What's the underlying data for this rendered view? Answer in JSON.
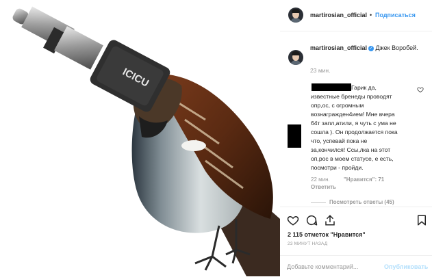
{
  "header": {
    "username": "martirosian_official",
    "separator": "•",
    "follow_label": "Подписаться"
  },
  "caption": {
    "username": "martirosian_official",
    "text": "Джек Воробей.",
    "time": "23 мин."
  },
  "comment": {
    "text_lines": [
      "Гарик да,",
      "известные бренеды проводят",
      "опр,ос, с огромным",
      "вознагражден4ием! Мне вчера",
      "64т запл,атили, я чуть с ума не",
      "сошла ). Он продолжается пока",
      "что, успевай пока не",
      "за,кончился! Ссы,лка на этот",
      "оп,рос в моем статусе, е есть,",
      "посмотри - пройди."
    ],
    "time": "22 мин.",
    "likes": "\"Нравится\": 71",
    "reply_label": "Ответить",
    "view_replies": "Посмотреть ответы (45)"
  },
  "post": {
    "likes_count": "2 115 отметок \"Нравится\"",
    "time_ago": "23 МИНУТ НАЗАД"
  },
  "add_comment": {
    "placeholder": "Добавьте комментарий...",
    "publish_label": "Опубликовать"
  },
  "colors": {
    "accent": "#3897f0",
    "text": "#262626",
    "muted": "#999999"
  },
  "icons": [
    "heart-icon",
    "comment-icon",
    "share-icon",
    "bookmark-icon",
    "verified-badge-icon",
    "like-comment-heart-icon"
  ],
  "media": {
    "plug_lettering": "ICICU"
  }
}
